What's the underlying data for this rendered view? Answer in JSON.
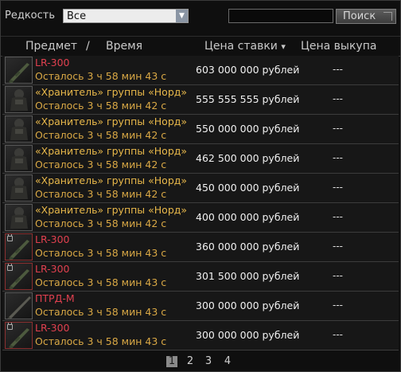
{
  "filters": {
    "rarity_label": "Редкость",
    "rarity_value": "Все",
    "search_value": "",
    "search_button": "Поиск"
  },
  "columns": {
    "item_time_a": "Предмет",
    "separator": "/",
    "item_time_b": "Время",
    "bid_price": "Цена ставки",
    "sort_glyph": "▾",
    "buyout_price": "Цена выкупа"
  },
  "rows": [
    {
      "name": "LR-300",
      "name_color": "red",
      "time": "Осталось 3 ч 58 мин 43 с",
      "bid": "603 000 000 рублей",
      "buyout": "---",
      "icon": "rifle-icon",
      "locked": false
    },
    {
      "name": "«Хранитель» группы «Норд»",
      "name_color": "gold",
      "time": "Осталось 3 ч 58 мин 42 с",
      "bid": "555 555 555 рублей",
      "buyout": "---",
      "icon": "armor-suit-icon",
      "locked": false
    },
    {
      "name": "«Хранитель» группы «Норд»",
      "name_color": "gold",
      "time": "Осталось 3 ч 58 мин 42 с",
      "bid": "550 000 000 рублей",
      "buyout": "---",
      "icon": "armor-suit-icon",
      "locked": false
    },
    {
      "name": "«Хранитель» группы «Норд»",
      "name_color": "gold",
      "time": "Осталось 3 ч 58 мин 42 с",
      "bid": "462 500 000 рублей",
      "buyout": "---",
      "icon": "armor-suit-icon",
      "locked": false
    },
    {
      "name": "«Хранитель» группы «Норд»",
      "name_color": "gold",
      "time": "Осталось 3 ч 58 мин 42 с",
      "bid": "450 000 000 рублей",
      "buyout": "---",
      "icon": "armor-suit-icon",
      "locked": false
    },
    {
      "name": "«Хранитель» группы «Норд»",
      "name_color": "gold",
      "time": "Осталось 3 ч 58 мин 42 с",
      "bid": "400 000 000 рублей",
      "buyout": "---",
      "icon": "armor-suit-icon",
      "locked": false
    },
    {
      "name": "LR-300",
      "name_color": "red",
      "time": "Осталось 3 ч 58 мин 43 с",
      "bid": "360 000 000 рублей",
      "buyout": "---",
      "icon": "rifle-icon",
      "locked": true
    },
    {
      "name": "LR-300",
      "name_color": "red",
      "time": "Осталось 3 ч 58 мин 43 с",
      "bid": "301 500 000 рублей",
      "buyout": "---",
      "icon": "rifle-icon",
      "locked": true
    },
    {
      "name": "ПТРД-М",
      "name_color": "red",
      "time": "Осталось 3 ч 58 мин 43 с",
      "bid": "300 000 000 рублей",
      "buyout": "---",
      "icon": "long-rifle-icon",
      "locked": false
    },
    {
      "name": "LR-300",
      "name_color": "red",
      "time": "Осталось 3 ч 58 мин 43 с",
      "bid": "300 000 000 рублей",
      "buyout": "---",
      "icon": "rifle-icon",
      "locked": true
    }
  ],
  "pagination": {
    "pages": [
      "1",
      "2",
      "3",
      "4"
    ],
    "current": "1"
  },
  "colors": {
    "name_red": "#e0404f",
    "name_gold": "#e8b84a",
    "time_gold": "#d9a845",
    "background": "#0f0f0f"
  }
}
